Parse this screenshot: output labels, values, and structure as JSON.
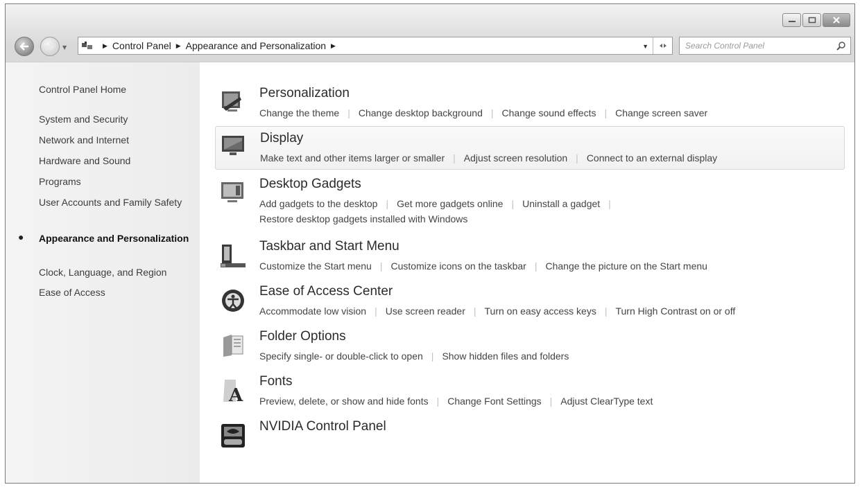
{
  "window": {
    "controls": {
      "minimize": "minimize-icon",
      "maximize": "maximize-icon",
      "close": "close-icon"
    }
  },
  "navigation": {
    "back": "back-arrow-icon",
    "forward": "forward-arrow-icon",
    "breadcrumb": [
      "Control Panel",
      "Appearance and Personalization"
    ],
    "search_placeholder": "Search Control Panel"
  },
  "sidebar": {
    "home": "Control Panel Home",
    "items": [
      "System and Security",
      "Network and Internet",
      "Hardware and Sound",
      "Programs",
      "User Accounts and Family Safety",
      "Appearance and Personalization",
      "Clock, Language, and Region",
      "Ease of Access"
    ],
    "active_index": 5
  },
  "categories": [
    {
      "title": "Personalization",
      "icon": "personalization-icon",
      "links": [
        "Change the theme",
        "Change desktop background",
        "Change sound effects",
        "Change screen saver"
      ]
    },
    {
      "title": "Display",
      "icon": "display-icon",
      "links": [
        "Make text and other items larger or smaller",
        "Adjust screen resolution",
        "Connect to an external display"
      ]
    },
    {
      "title": "Desktop Gadgets",
      "icon": "desktop-gadgets-icon",
      "links": [
        "Add gadgets to the desktop",
        "Get more gadgets online",
        "Uninstall a gadget",
        "Restore desktop gadgets installed with Windows"
      ]
    },
    {
      "title": "Taskbar and Start Menu",
      "icon": "taskbar-icon",
      "links": [
        "Customize the Start menu",
        "Customize icons on the taskbar",
        "Change the picture on the Start menu"
      ]
    },
    {
      "title": "Ease of Access Center",
      "icon": "ease-of-access-icon",
      "links": [
        "Accommodate low vision",
        "Use screen reader",
        "Turn on easy access keys",
        "Turn High Contrast on or off"
      ]
    },
    {
      "title": "Folder Options",
      "icon": "folder-options-icon",
      "links": [
        "Specify single- or double-click to open",
        "Show hidden files and folders"
      ]
    },
    {
      "title": "Fonts",
      "icon": "fonts-icon",
      "links": [
        "Preview, delete, or show and hide fonts",
        "Change Font Settings",
        "Adjust ClearType text"
      ]
    },
    {
      "title": "NVIDIA Control Panel",
      "icon": "nvidia-icon",
      "links": []
    }
  ]
}
